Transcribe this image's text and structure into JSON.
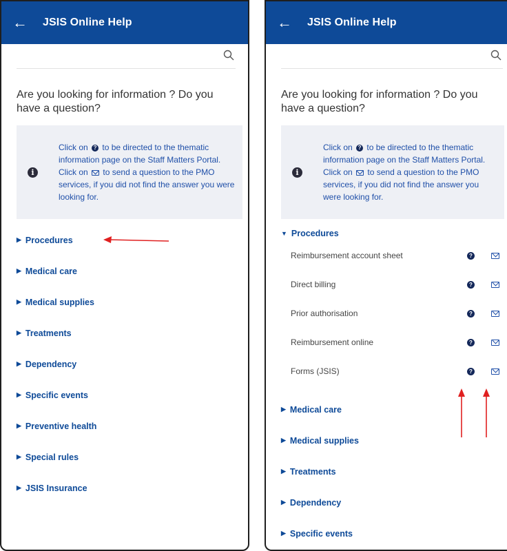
{
  "colors": {
    "header": "#0e4a98",
    "info_box": "#eef0f5",
    "link": "#0e4a98",
    "annotation_arrow": "#e02020"
  },
  "left": {
    "header": {
      "back_icon": "←",
      "title": "JSIS Online Help"
    },
    "question": "Are you looking for information ? Do you have a question?",
    "info": {
      "icon": "i",
      "line1_pre": "Click on",
      "line1_post": "to be directed to the thematic information page on the Staff Matters Portal.",
      "line2_pre": "Click on",
      "line2_post": "to send a question to the PMO services, if you did not find the answer you were looking for."
    },
    "sections": [
      {
        "label": "Procedures"
      },
      {
        "label": "Medical care"
      },
      {
        "label": "Medical supplies"
      },
      {
        "label": "Treatments"
      },
      {
        "label": "Dependency"
      },
      {
        "label": "Specific events"
      },
      {
        "label": "Preventive health"
      },
      {
        "label": "Special rules"
      },
      {
        "label": "JSIS Insurance"
      }
    ]
  },
  "right": {
    "header": {
      "back_icon": "←",
      "title": "JSIS Online Help"
    },
    "question": "Are you looking for information ? Do you have a question?",
    "info": {
      "line1_pre": "Click on",
      "line1_post": "to be directed to the thematic information page on the Staff Matters Portal.",
      "line2_pre": "Click on",
      "line2_post": "to send a question to the PMO services, if you did not find the answer you were looking for."
    },
    "expanded_section": "Procedures",
    "sub_items": [
      {
        "label": "Reimbursement account sheet"
      },
      {
        "label": "Direct billing"
      },
      {
        "label": "Prior authorisation"
      },
      {
        "label": "Reimbursement online"
      },
      {
        "label": "Forms (JSIS)"
      }
    ],
    "sections": [
      {
        "label": "Medical care"
      },
      {
        "label": "Medical supplies"
      },
      {
        "label": "Treatments"
      },
      {
        "label": "Dependency"
      },
      {
        "label": "Specific events"
      }
    ]
  }
}
